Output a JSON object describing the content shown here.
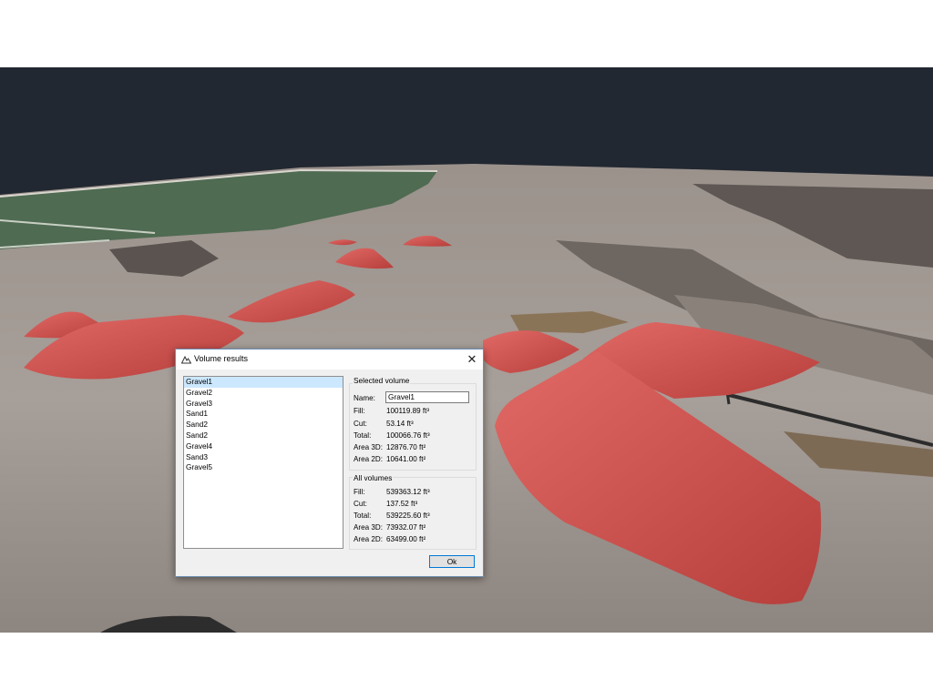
{
  "dialog": {
    "title": "Volume results",
    "icon": "mountains-icon",
    "close_label": "✕",
    "ok_label": "Ok"
  },
  "volumes_list": [
    "Gravel1",
    "Gravel2",
    "Gravel3",
    "Sand1",
    "Sand2",
    "Sand2",
    "Gravel4",
    "Sand3",
    "Gravel5"
  ],
  "selected_index": 0,
  "selected_volume": {
    "group_label": "Selected volume",
    "name_label": "Name:",
    "name_value": "Gravel1",
    "rows": [
      {
        "label": "Fill:",
        "value": "100119.89 ft³"
      },
      {
        "label": "Cut:",
        "value": "53.14 ft³"
      },
      {
        "label": "Total:",
        "value": "100066.76 ft³"
      },
      {
        "label": "Area 3D:",
        "value": "12876.70 ft²"
      },
      {
        "label": "Area 2D:",
        "value": "10641.00 ft²"
      }
    ]
  },
  "all_volumes": {
    "group_label": "All volumes",
    "rows": [
      {
        "label": "Fill:",
        "value": "539363.12 ft³"
      },
      {
        "label": "Cut:",
        "value": "137.52 ft³"
      },
      {
        "label": "Total:",
        "value": "539225.60 ft³"
      },
      {
        "label": "Area 3D:",
        "value": "73932.07 ft²"
      },
      {
        "label": "Area 2D:",
        "value": "63499.00 ft²"
      }
    ]
  },
  "colors": {
    "sky": "#222831",
    "terrain": "#a69d97",
    "stockpile": "#d9534f",
    "grass": "#4f6b52",
    "selection": "#cce8ff",
    "ok_border": "#0078d7"
  }
}
